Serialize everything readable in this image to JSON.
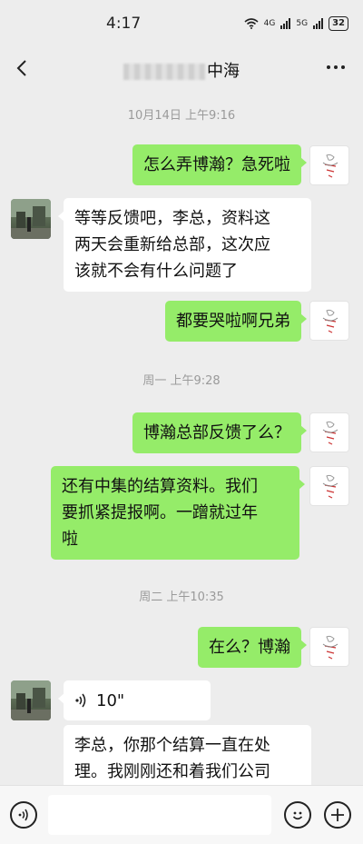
{
  "status_bar": {
    "time": "4:17",
    "net_1": "4G",
    "net_2": "5G",
    "battery": "32"
  },
  "header": {
    "title_visible": "中海",
    "back_icon": "chevron-left-icon",
    "more_icon": "more-dots-icon"
  },
  "messages": {
    "ts_1": "10月14日 上午9:16",
    "m1": "怎么弄博瀚？急死啦",
    "m2_l1": "等等反馈吧，李总，资料这",
    "m2_l2": "两天会重新给总部，这次应",
    "m2_l3": "该就不会有什么问题了",
    "m3": "都要哭啦啊兄弟",
    "ts_2": "周一 上午9:28",
    "m4": "博瀚总部反馈了么？",
    "m5_l1": "还有中集的结算资料。我们",
    "m5_l2": "要抓紧提报啊。一蹭就过年",
    "m5_l3": "啦",
    "ts_3": "周二 上午10:35",
    "m6": "在么？博瀚",
    "m7_voice": "10\"",
    "m8_l1": "李总，你那个结算一直在处",
    "m8_l2": "理。我刚刚还和着我们公司"
  },
  "input_bar": {
    "voice_icon": "voice-mode-icon",
    "emoji_icon": "emoji-icon",
    "add_icon": "plus-icon"
  },
  "colors": {
    "background": "#ededed",
    "self_bubble": "#95ec69",
    "other_bubble": "#ffffff",
    "timestamp": "#9a9a9a"
  }
}
